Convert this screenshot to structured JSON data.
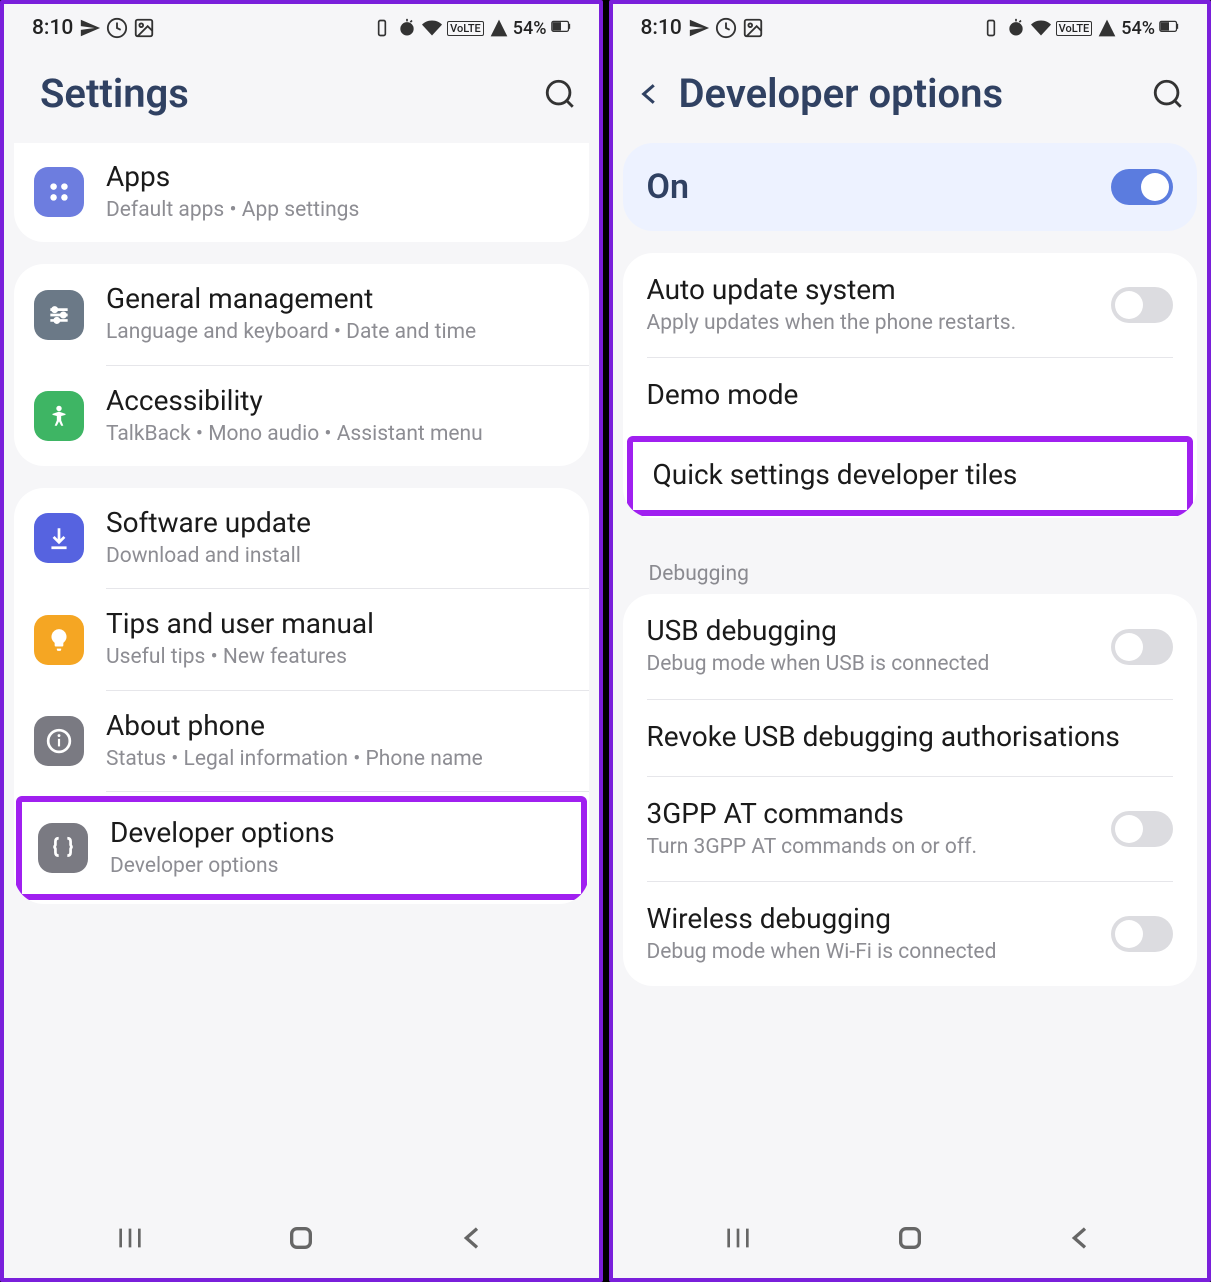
{
  "statusbar": {
    "time": "8:10",
    "battery_text": "54%"
  },
  "left_screen": {
    "header_title": "Settings",
    "card1": {
      "apps": {
        "title": "Apps",
        "sub": "Default apps  •  App settings"
      }
    },
    "card2": {
      "general": {
        "title": "General management",
        "sub": "Language and keyboard  •  Date and time"
      },
      "accessibility": {
        "title": "Accessibility",
        "sub": "TalkBack  •  Mono audio  •  Assistant menu"
      }
    },
    "card3": {
      "software": {
        "title": "Software update",
        "sub": "Download and install"
      },
      "tips": {
        "title": "Tips and user manual",
        "sub": "Useful tips  •  New features"
      },
      "about": {
        "title": "About phone",
        "sub": "Status  •  Legal information  •  Phone name"
      },
      "dev": {
        "title": "Developer options",
        "sub": "Developer options"
      }
    }
  },
  "right_screen": {
    "header_title": "Developer options",
    "main_toggle": {
      "label": "On"
    },
    "card1": {
      "auto_update": {
        "title": "Auto update system",
        "sub": "Apply updates when the phone restarts."
      },
      "demo": {
        "title": "Demo mode"
      },
      "quick_tiles": {
        "title": "Quick settings developer tiles"
      }
    },
    "section_debug": "Debugging",
    "card2": {
      "usb": {
        "title": "USB debugging",
        "sub": "Debug mode when USB is connected"
      },
      "revoke": {
        "title": "Revoke USB debugging authorisations"
      },
      "gpp": {
        "title": "3GPP AT commands",
        "sub": "Turn 3GPP AT commands on or off."
      },
      "wireless": {
        "title": "Wireless debugging",
        "sub": "Debug mode when Wi-Fi is connected"
      }
    }
  }
}
